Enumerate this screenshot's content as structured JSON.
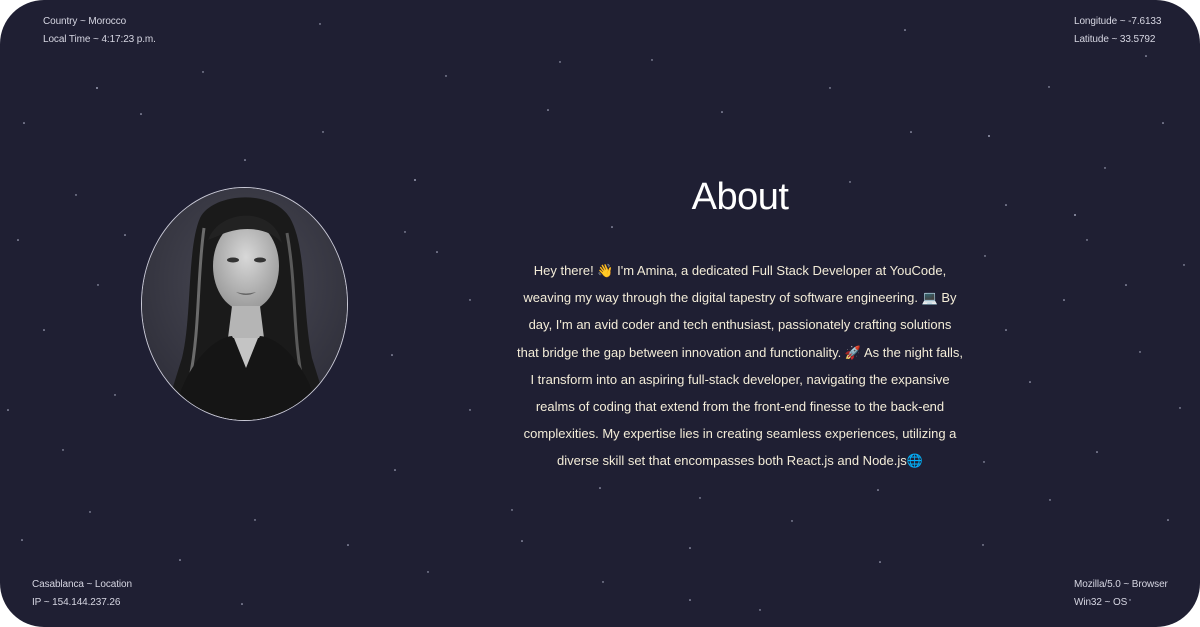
{
  "info": {
    "country": "Country ~ Morocco",
    "local_time": "Local Time ~ 4:17:23 p.m.",
    "longitude": "Longitude ~ -7.6133",
    "latitude": "Latitude ~ 33.5792",
    "location": "Casablanca ~ Location",
    "ip": "IP ~ 154.144.237.26",
    "browser": "Mozilla/5.0 ~ Browser",
    "os": "Win32 ~ OS"
  },
  "about": {
    "title": "About",
    "paragraph": "Hey there! 👋 I'm Amina, a dedicated Full Stack Developer at YouCode, weaving my way through the digital tapestry of software engineering. 💻 By day, I'm an avid coder and tech enthusiast, passionately crafting solutions that bridge the gap between innovation and functionality. 🚀 As the night falls, I transform into an aspiring full-stack developer, navigating the expansive realms of coding that extend from the front-end finesse to the back-end complexities. My expertise lies in creating seamless experiences, utilizing a diverse skill set that encompasses both React.js and Node.js🌐"
  },
  "colors": {
    "background": "#1f1f33",
    "title": "#ffffff",
    "text": "#f3ecd8",
    "portrait_border": "#c9c9d6"
  }
}
